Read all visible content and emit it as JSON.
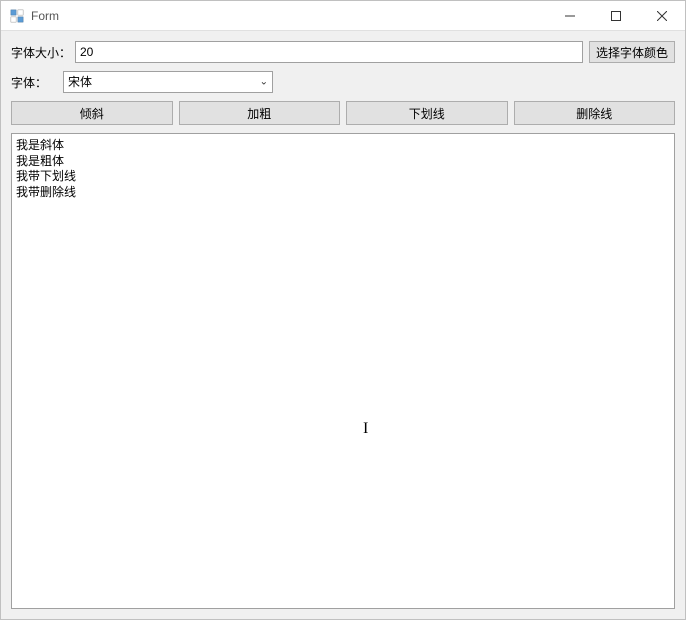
{
  "window": {
    "title": "Form"
  },
  "labels": {
    "fontSize": "字体大小：",
    "font": "字体："
  },
  "inputs": {
    "fontSizeValue": "20",
    "fontSelected": "宋体"
  },
  "buttons": {
    "chooseColor": "选择字体颜色",
    "italic": "倾斜",
    "bold": "加粗",
    "underline": "下划线",
    "strikethrough": "删除线"
  },
  "textContent": "我是斜体\n我是粗体\n我带下划线\n我带删除线"
}
